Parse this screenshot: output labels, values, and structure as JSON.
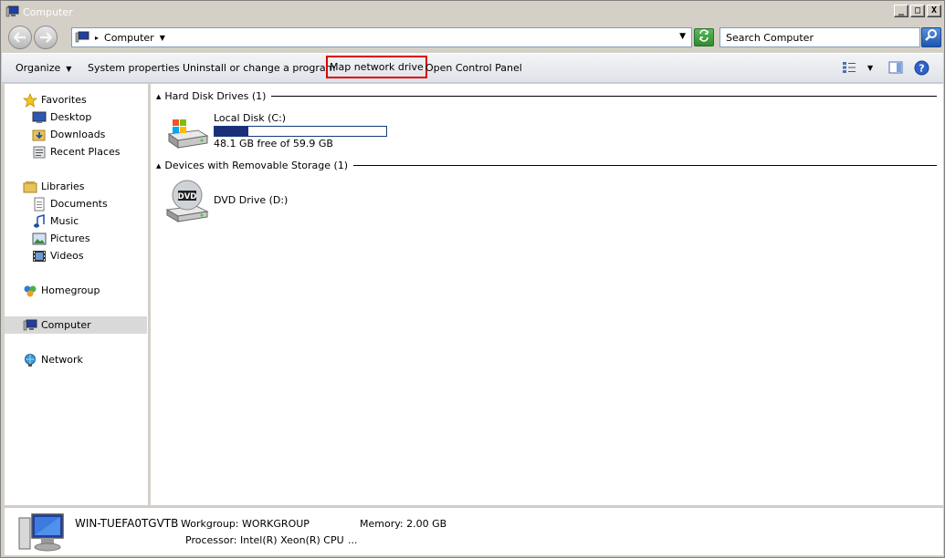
{
  "window": {
    "title": "Computer",
    "controls": {
      "minimize": "_",
      "maximize": "□",
      "close": "X"
    }
  },
  "address": {
    "crumb": "Computer",
    "search_placeholder": "Search Computer"
  },
  "commandbar": {
    "organize": "Organize",
    "system_properties": "System properties",
    "uninstall": "Uninstall or change a program",
    "map_network_drive": "Map network drive",
    "open_control_panel": "Open Control Panel"
  },
  "nav": {
    "favorites": "Favorites",
    "desktop": "Desktop",
    "downloads": "Downloads",
    "recent_places": "Recent Places",
    "libraries": "Libraries",
    "documents": "Documents",
    "music": "Music",
    "pictures": "Pictures",
    "videos": "Videos",
    "homegroup": "Homegroup",
    "computer": "Computer",
    "network": "Network"
  },
  "content": {
    "hdd_group": "Hard Disk Drives (1)",
    "removable_group": "Devices with Removable Storage (1)",
    "local_disk": {
      "name": "Local Disk (C:)",
      "free_text": "48.1 GB free of 59.9 GB",
      "used_fraction": 0.197
    },
    "dvd": {
      "name": "DVD Drive (D:)",
      "label": "DVD"
    }
  },
  "details": {
    "computer_name": "WIN-TUEFA0TGVTB",
    "workgroup": "Workgroup: WORKGROUP",
    "memory": "Memory: 2.00 GB",
    "processor": "Processor: Intel(R) Xeon(R) CPU",
    "ellipsis": "..."
  },
  "colors": {
    "highlight_box": "#e00000",
    "disk_bar": "#1b2e7a",
    "nav_selected": "#d9d9d9"
  }
}
